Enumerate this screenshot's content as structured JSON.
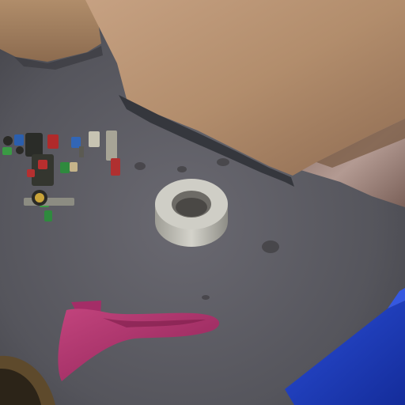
{
  "scene": {
    "objects": [
      {
        "name": "cardboard-box",
        "color": "#b69271"
      },
      {
        "name": "small-cardboard-box",
        "color": "#a8855f"
      },
      {
        "name": "wooden-floor",
        "color": "#9c7f74"
      },
      {
        "name": "carpet",
        "color": "#5a5961"
      },
      {
        "name": "toy-robot-parts",
        "color": "#2b2d28"
      },
      {
        "name": "duct-tape-roll",
        "color": "#c9c8c0"
      },
      {
        "name": "pink-shoe",
        "color": "#b1346f"
      },
      {
        "name": "blue-box",
        "color": "#1d3ec2"
      },
      {
        "name": "brown-bowl",
        "color": "#5e4a2c"
      }
    ]
  }
}
